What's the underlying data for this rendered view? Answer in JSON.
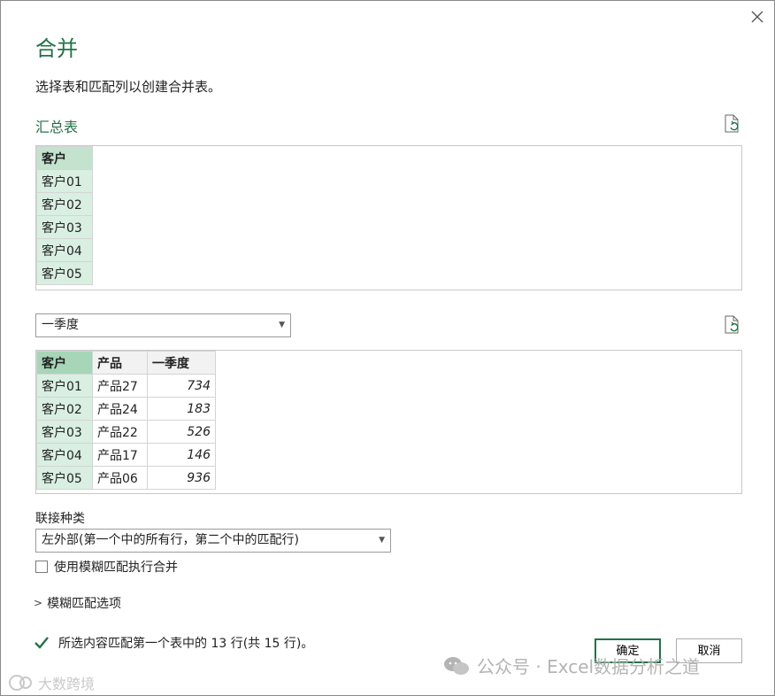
{
  "dialog": {
    "title": "合并",
    "subtitle": "选择表和匹配列以创建合并表。",
    "close_icon": "close-icon"
  },
  "summary": {
    "label": "汇总表",
    "header": "客户",
    "rows": [
      "客户01",
      "客户02",
      "客户03",
      "客户04",
      "客户05"
    ]
  },
  "second": {
    "selected_table": "一季度",
    "headers": [
      "客户",
      "产品",
      "一季度"
    ],
    "rows": [
      [
        "客户01",
        "产品27",
        "734"
      ],
      [
        "客户02",
        "产品24",
        "183"
      ],
      [
        "客户03",
        "产品22",
        "526"
      ],
      [
        "客户04",
        "产品17",
        "146"
      ],
      [
        "客户05",
        "产品06",
        "936"
      ]
    ]
  },
  "join": {
    "label": "联接种类",
    "selected": "左外部(第一个中的所有行，第二个中的匹配行)"
  },
  "fuzzy": {
    "checkbox_label": "使用模糊匹配执行合并",
    "checked": false,
    "options_label": "模糊匹配选项"
  },
  "status": {
    "text": "所选内容匹配第一个表中的 13 行(共 15 行)。"
  },
  "buttons": {
    "ok": "确定",
    "cancel": "取消"
  },
  "watermark": {
    "text": "公众号 · Excel数据分析之道",
    "text2": "大数跨境"
  },
  "colors": {
    "accent": "#217346",
    "match_column": "#d9efe1",
    "selected_header": "#a6d6b7"
  }
}
